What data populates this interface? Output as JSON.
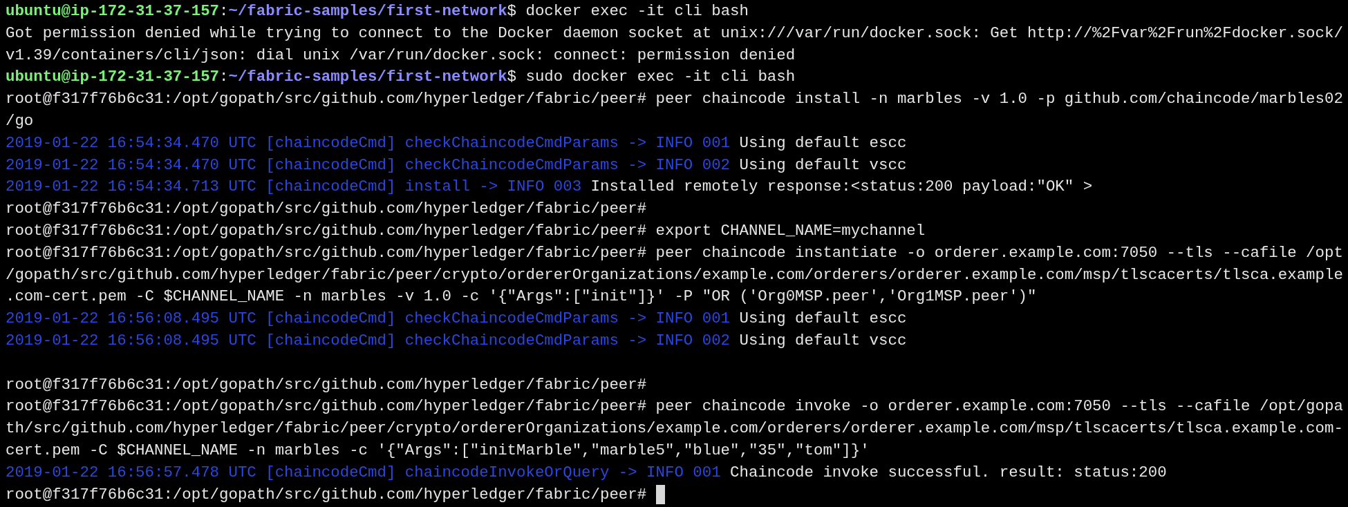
{
  "terminal": {
    "lines": [
      {
        "kind": "text",
        "segments": [
          {
            "kind": "user_host",
            "text": "ubuntu@ip-172-31-37-157"
          },
          {
            "kind": "plain",
            "text": ":"
          },
          {
            "kind": "path",
            "text": "~/fabric-samples/first-network"
          },
          {
            "kind": "plain",
            "text": "$ docker exec -it cli bash"
          }
        ]
      },
      {
        "kind": "text",
        "segments": [
          {
            "kind": "plain",
            "text": "Got permission denied while trying to connect to the Docker daemon socket at unix:///var/run/docker.sock: Get http://%2Fvar%2Frun%2Fdocker.sock/"
          }
        ]
      },
      {
        "kind": "text",
        "segments": [
          {
            "kind": "plain",
            "text": "v1.39/containers/cli/json: dial unix /var/run/docker.sock: connect: permission denied"
          }
        ]
      },
      {
        "kind": "text",
        "segments": [
          {
            "kind": "user_host",
            "text": "ubuntu@ip-172-31-37-157"
          },
          {
            "kind": "plain",
            "text": ":"
          },
          {
            "kind": "path",
            "text": "~/fabric-samples/first-network"
          },
          {
            "kind": "plain",
            "text": "$ sudo docker exec -it cli bash"
          }
        ]
      },
      {
        "kind": "text",
        "segments": [
          {
            "kind": "plain",
            "text": "root@f317f76b6c31:/opt/gopath/src/github.com/hyperledger/fabric/peer# peer chaincode install -n marbles -v 1.0 -p github.com/chaincode/marbles02"
          }
        ]
      },
      {
        "kind": "text",
        "segments": [
          {
            "kind": "plain",
            "text": "/go"
          }
        ]
      },
      {
        "kind": "text",
        "segments": [
          {
            "kind": "log",
            "text": "2019-01-22 16:54:34.470 UTC [chaincodeCmd] checkChaincodeCmdParams -> INFO 001"
          },
          {
            "kind": "plain",
            "text": " Using default escc"
          }
        ]
      },
      {
        "kind": "text",
        "segments": [
          {
            "kind": "log",
            "text": "2019-01-22 16:54:34.470 UTC [chaincodeCmd] checkChaincodeCmdParams -> INFO 002"
          },
          {
            "kind": "plain",
            "text": " Using default vscc"
          }
        ]
      },
      {
        "kind": "text",
        "segments": [
          {
            "kind": "log",
            "text": "2019-01-22 16:54:34.713 UTC [chaincodeCmd] install -> INFO 003"
          },
          {
            "kind": "plain",
            "text": " Installed remotely response:<status:200 payload:\"OK\" >"
          }
        ]
      },
      {
        "kind": "text",
        "segments": [
          {
            "kind": "plain",
            "text": "root@f317f76b6c31:/opt/gopath/src/github.com/hyperledger/fabric/peer#"
          }
        ]
      },
      {
        "kind": "text",
        "segments": [
          {
            "kind": "plain",
            "text": "root@f317f76b6c31:/opt/gopath/src/github.com/hyperledger/fabric/peer# export CHANNEL_NAME=mychannel"
          }
        ]
      },
      {
        "kind": "text",
        "segments": [
          {
            "kind": "plain",
            "text": "root@f317f76b6c31:/opt/gopath/src/github.com/hyperledger/fabric/peer# peer chaincode instantiate -o orderer.example.com:7050 --tls --cafile /opt"
          }
        ]
      },
      {
        "kind": "text",
        "segments": [
          {
            "kind": "plain",
            "text": "/gopath/src/github.com/hyperledger/fabric/peer/crypto/ordererOrganizations/example.com/orderers/orderer.example.com/msp/tlscacerts/tlsca.example"
          }
        ]
      },
      {
        "kind": "text",
        "segments": [
          {
            "kind": "plain",
            "text": ".com-cert.pem -C $CHANNEL_NAME -n marbles -v 1.0 -c '{\"Args\":[\"init\"]}' -P \"OR ('Org0MSP.peer','Org1MSP.peer')\""
          }
        ]
      },
      {
        "kind": "text",
        "segments": [
          {
            "kind": "log",
            "text": "2019-01-22 16:56:08.495 UTC [chaincodeCmd] checkChaincodeCmdParams -> INFO 001"
          },
          {
            "kind": "plain",
            "text": " Using default escc"
          }
        ]
      },
      {
        "kind": "text",
        "segments": [
          {
            "kind": "log",
            "text": "2019-01-22 16:56:08.495 UTC [chaincodeCmd] checkChaincodeCmdParams -> INFO 002"
          },
          {
            "kind": "plain",
            "text": " Using default vscc"
          }
        ]
      },
      {
        "kind": "blank"
      },
      {
        "kind": "text",
        "segments": [
          {
            "kind": "plain",
            "text": "root@f317f76b6c31:/opt/gopath/src/github.com/hyperledger/fabric/peer#"
          }
        ]
      },
      {
        "kind": "text",
        "segments": [
          {
            "kind": "plain",
            "text": "root@f317f76b6c31:/opt/gopath/src/github.com/hyperledger/fabric/peer# peer chaincode invoke -o orderer.example.com:7050 --tls --cafile /opt/gopa"
          }
        ]
      },
      {
        "kind": "text",
        "segments": [
          {
            "kind": "plain",
            "text": "th/src/github.com/hyperledger/fabric/peer/crypto/ordererOrganizations/example.com/orderers/orderer.example.com/msp/tlscacerts/tlsca.example.com-"
          }
        ]
      },
      {
        "kind": "text",
        "segments": [
          {
            "kind": "plain",
            "text": "cert.pem -C $CHANNEL_NAME -n marbles -c '{\"Args\":[\"initMarble\",\"marble5\",\"blue\",\"35\",\"tom\"]}'"
          }
        ]
      },
      {
        "kind": "text",
        "segments": [
          {
            "kind": "log",
            "text": "2019-01-22 16:56:57.478 UTC [chaincodeCmd] chaincodeInvokeOrQuery -> INFO 001"
          },
          {
            "kind": "plain",
            "text": " Chaincode invoke successful. result: status:200"
          }
        ]
      },
      {
        "kind": "prompt",
        "segments": [
          {
            "kind": "plain",
            "text": "root@f317f76b6c31:/opt/gopath/src/github.com/hyperledger/fabric/peer# "
          }
        ]
      }
    ]
  }
}
